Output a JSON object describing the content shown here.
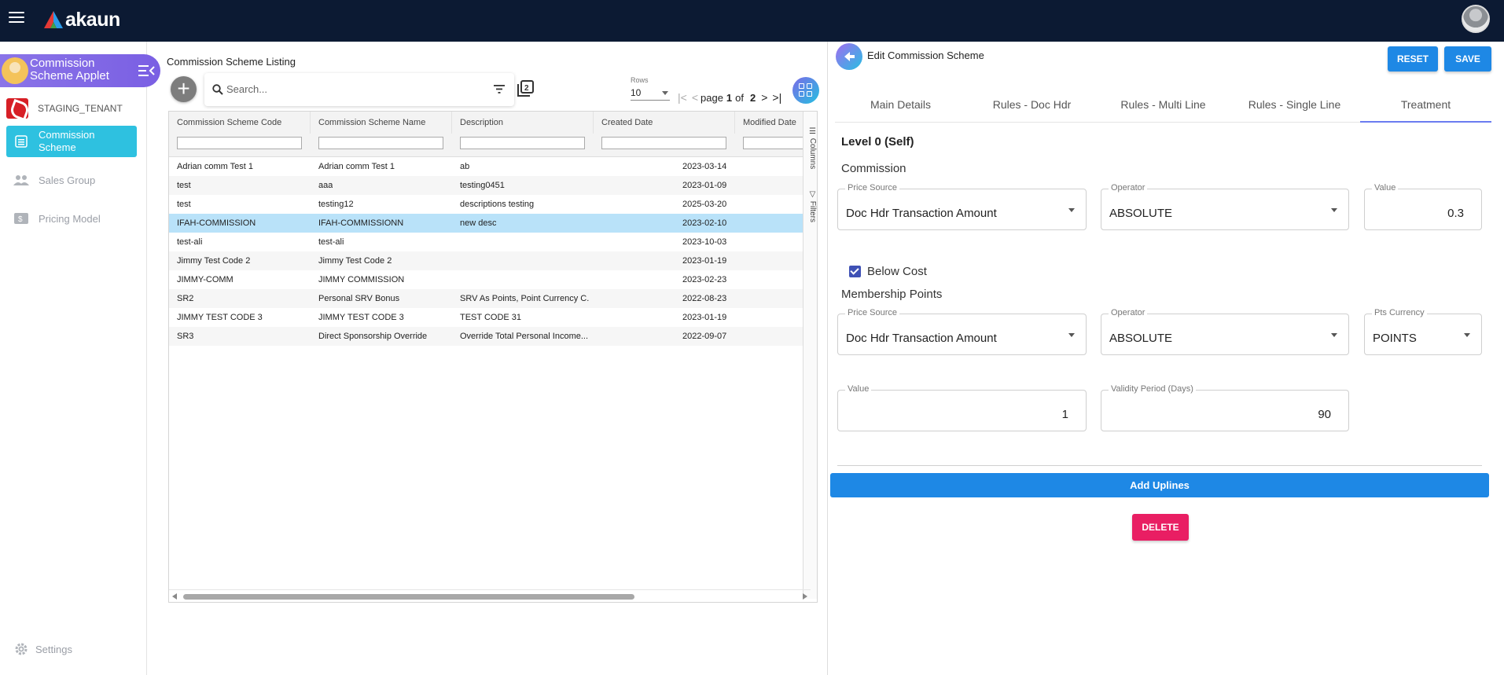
{
  "app": {
    "logo_text": "akaun"
  },
  "sidebar": {
    "applet_title": "Commission Scheme Applet",
    "tenant": "STAGING_TENANT",
    "items": [
      {
        "label": "Commission Scheme",
        "icon": "list-icon",
        "active": true
      },
      {
        "label": "Sales Group",
        "icon": "group-icon",
        "active": false
      },
      {
        "label": "Pricing Model",
        "icon": "dollar-icon",
        "active": false
      }
    ],
    "settings_label": "Settings"
  },
  "listing": {
    "title": "Commission Scheme Listing",
    "search_placeholder": "Search...",
    "rows_label": "Rows",
    "rows_value": "10",
    "page_word": "page",
    "page_current": "1",
    "of_word": "of",
    "page_total": "2",
    "columns": [
      "Commission Scheme Code",
      "Commission Scheme Name",
      "Description",
      "Created Date",
      "Modified Date"
    ],
    "side_tabs": {
      "columns": "Columns",
      "filters": "Filters"
    },
    "rows": [
      {
        "code": "Adrian comm Test 1",
        "name": "Adrian comm Test 1",
        "desc": "ab",
        "created": "2023-03-14"
      },
      {
        "code": "test",
        "name": "aaa",
        "desc": "testing0451",
        "created": "2023-01-09"
      },
      {
        "code": "test",
        "name": "testing12",
        "desc": "descriptions testing",
        "created": "2025-03-20"
      },
      {
        "code": "IFAH-COMMISSION",
        "name": "IFAH-COMMISSIONN",
        "desc": "new desc",
        "created": "2023-02-10",
        "selected": true
      },
      {
        "code": "test-ali",
        "name": "test-ali",
        "desc": "",
        "created": "2023-10-03"
      },
      {
        "code": "Jimmy Test Code 2",
        "name": "Jimmy Test Code 2",
        "desc": "",
        "created": "2023-01-19"
      },
      {
        "code": "JIMMY-COMM",
        "name": "JIMMY COMMISSION",
        "desc": "",
        "created": "2023-02-23"
      },
      {
        "code": "SR2",
        "name": "Personal SRV Bonus",
        "desc": "SRV As Points, Point Currency C...",
        "created": "2022-08-23"
      },
      {
        "code": "JIMMY TEST CODE 3",
        "name": "JIMMY TEST CODE 3",
        "desc": "TEST CODE 31",
        "created": "2023-01-19"
      },
      {
        "code": "SR3",
        "name": "Direct Sponsorship Override",
        "desc": "Override Total Personal Income...",
        "created": "2022-09-07"
      }
    ]
  },
  "edit": {
    "title": "Edit Commission Scheme",
    "reset_label": "RESET",
    "save_label": "SAVE",
    "tabs": [
      "Main Details",
      "Rules - Doc Hdr",
      "Rules - Multi Line",
      "Rules - Single Line",
      "Treatment"
    ],
    "active_tab": "Treatment",
    "level_title": "Level 0 (Self)",
    "commission": {
      "heading": "Commission",
      "price_source_label": "Price Source",
      "price_source_value": "Doc Hdr Transaction Amount",
      "operator_label": "Operator",
      "operator_value": "ABSOLUTE",
      "value_label": "Value",
      "value_value": "0.3"
    },
    "below_cost_label": "Below Cost",
    "below_cost_checked": true,
    "membership": {
      "heading": "Membership Points",
      "price_source_label": "Price Source",
      "price_source_value": "Doc Hdr Transaction Amount",
      "operator_label": "Operator",
      "operator_value": "ABSOLUTE",
      "currency_label": "Pts Currency",
      "currency_value": "POINTS",
      "value_label": "Value",
      "value_value": "1",
      "validity_label": "Validity Period (Days)",
      "validity_value": "90"
    },
    "add_uplines_label": "Add Uplines",
    "delete_label": "DELETE"
  },
  "colors": {
    "topbar": "#0c1a33",
    "accent_blue": "#1e88e5",
    "delete_pink": "#e91e63",
    "active_nav": "#2ec1e0",
    "selected_row": "#b9e2f9"
  }
}
